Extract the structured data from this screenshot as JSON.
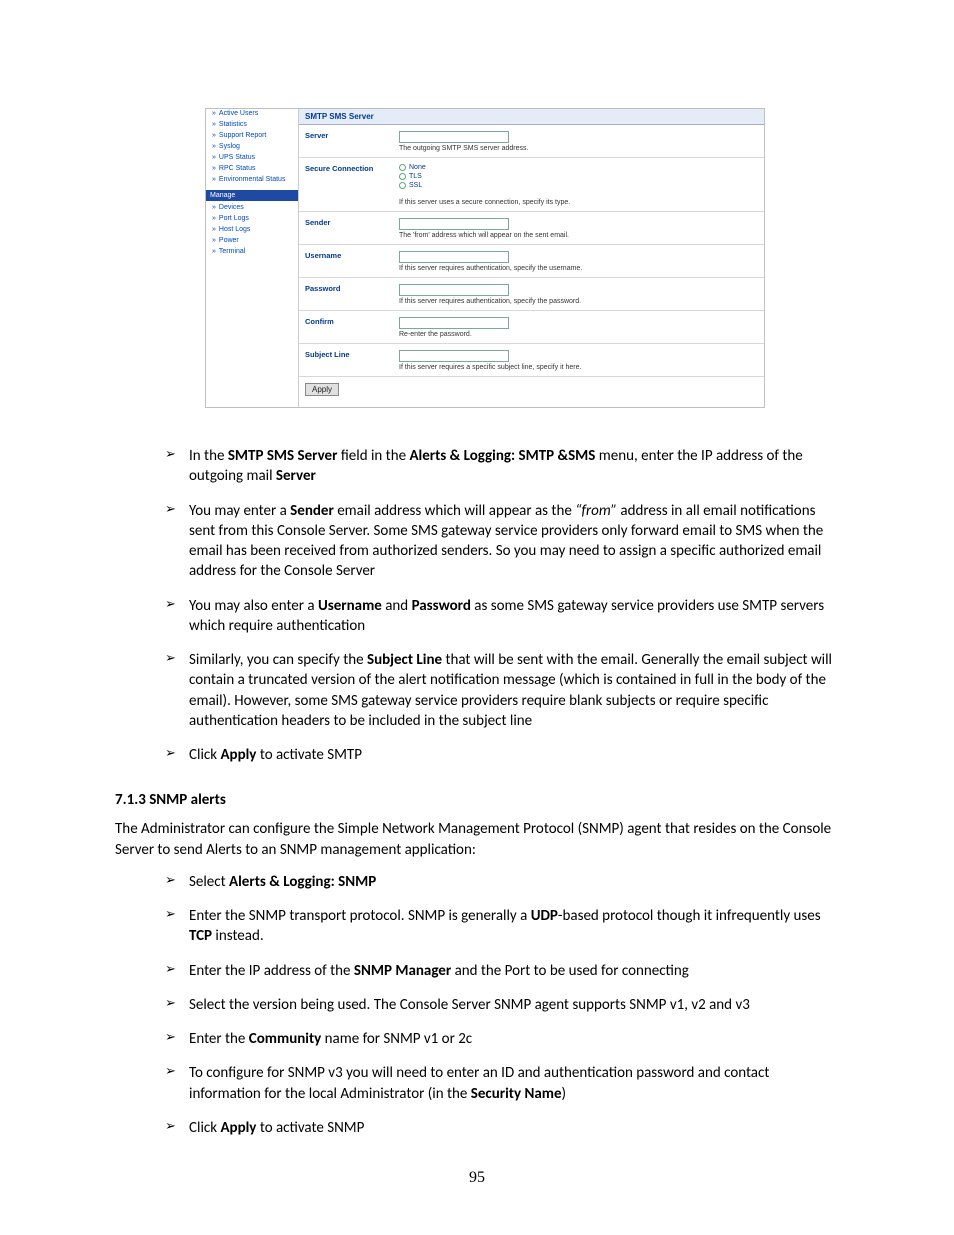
{
  "screenshot": {
    "nav_items_top": [
      "Active Users",
      "Statistics",
      "Support Report",
      "Syslog",
      "UPS Status",
      "RPC Status",
      "Environmental Status"
    ],
    "section_manage": "Manage",
    "nav_items_manage": [
      "Devices",
      "Port Logs",
      "Host Logs",
      "Power",
      "Terminal"
    ],
    "panel_title": "SMTP SMS Server",
    "rows": {
      "server": {
        "label": "Server",
        "help": "The outgoing SMTP SMS server address."
      },
      "secure": {
        "label": "Secure Connection",
        "help": "If this server uses a secure connection, specify its type.",
        "opts": [
          "None",
          "TLS",
          "SSL"
        ]
      },
      "sender": {
        "label": "Sender",
        "help": "The 'from' address which will appear on the sent email."
      },
      "username": {
        "label": "Username",
        "help": "If this server requires authentication, specify the username."
      },
      "password": {
        "label": "Password",
        "help": "If this server requires authentication, specify the password."
      },
      "confirm": {
        "label": "Confirm",
        "help": "Re-enter the password."
      },
      "subject": {
        "label": "Subject Line",
        "help": "If this server requires a specific subject line, specify it here."
      }
    },
    "apply": "Apply"
  },
  "bullets1": {
    "b0": {
      "pre": "In the ",
      "k1": "SMTP SMS Server",
      "mid1": " field in the ",
      "k2": "Alerts & Logging: SMTP &SMS",
      "mid2": " menu, enter the IP address of the outgoing mail ",
      "k3": "Server"
    },
    "b1": {
      "pre": "You may enter a ",
      "k1": "Sender",
      "mid1": " email address which will appear as the ",
      "it": "“from”",
      "rest": " address in all email notifications sent from this Console Server. Some SMS gateway service providers only forward email to SMS when the email has been received from authorized senders. So you may need to assign a specific authorized email address for the Console Server"
    },
    "b2": {
      "pre": "You may also enter a ",
      "k1": "Username",
      "mid1": " and ",
      "k2": "Password",
      "rest": " as some SMS gateway service providers use SMTP servers which require authentication"
    },
    "b3": {
      "pre": "Similarly, you can specify the ",
      "k1": "Subject Line",
      "rest": " that will be sent with the email. Generally the email subject will contain a truncated version of the alert notification message (which is contained in full in the body of the email). However, some SMS gateway service providers require blank subjects or require specific authentication headers to be included in the subject line"
    },
    "b4": {
      "pre": "Click ",
      "k1": "Apply",
      "rest": " to activate SMTP"
    }
  },
  "section_heading": "7.1.3    SNMP alerts",
  "snmp_intro": "The Administrator can configure the Simple Network Management Protocol (SNMP) agent that resides on the Console Server to send Alerts to an SNMP management application:",
  "bullets2": {
    "b0": {
      "pre": "Select ",
      "k1": "Alerts & Logging: SNMP"
    },
    "b1": {
      "pre": "Enter the SNMP transport protocol. SNMP is generally a ",
      "k1": "UDP",
      "mid1": "-based protocol though it infrequently uses ",
      "k2": "TCP",
      "rest": " instead."
    },
    "b2": {
      "pre": "Enter the IP address of the ",
      "k1": "SNMP Manager",
      "rest": " and the Port to be used for connecting"
    },
    "b3": {
      "text": "Select the version being used. The Console Server SNMP agent supports SNMP v1, v2 and v3"
    },
    "b4": {
      "pre": "Enter the ",
      "k1": "Community",
      "rest": " name for SNMP v1 or 2c"
    },
    "b5": {
      "pre": "To configure for SNMP v3 you will need to enter an ID and authentication password and contact information for the local Administrator (in the ",
      "k1": "Security Name",
      "rest": ")"
    },
    "b6": {
      "pre": "Click ",
      "k1": "Apply",
      "rest": " to activate SNMP"
    }
  },
  "page_number": "95"
}
